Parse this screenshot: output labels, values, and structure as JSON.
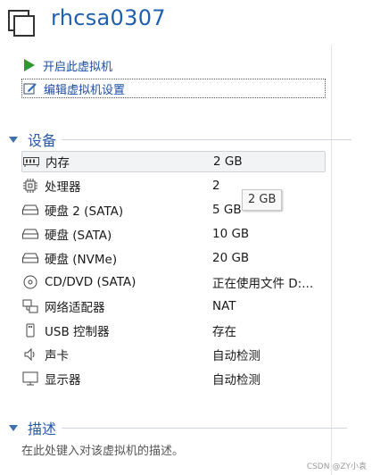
{
  "vm": {
    "title": "rhcsa0307"
  },
  "actions": {
    "start": "开启此虚拟机",
    "edit": "编辑虚拟机设置"
  },
  "devices": {
    "heading": "设备",
    "rows": [
      {
        "name": "内存",
        "value": "2 GB",
        "icon": "memory-icon"
      },
      {
        "name": "处理器",
        "value": "2",
        "icon": "processor-icon"
      },
      {
        "name": "硬盘 2 (SATA)",
        "value": "5 GB",
        "icon": "hard-disk-icon"
      },
      {
        "name": "硬盘 (SATA)",
        "value": "10 GB",
        "icon": "hard-disk-icon"
      },
      {
        "name": "硬盘 (NVMe)",
        "value": "20 GB",
        "icon": "hard-disk-icon"
      },
      {
        "name": "CD/DVD (SATA)",
        "value": "正在使用文件 D:...",
        "icon": "cd-dvd-icon"
      },
      {
        "name": "网络适配器",
        "value": "NAT",
        "icon": "network-adapter-icon"
      },
      {
        "name": "USB 控制器",
        "value": "存在",
        "icon": "usb-icon"
      },
      {
        "name": "声卡",
        "value": "自动检测",
        "icon": "speaker-icon"
      },
      {
        "name": "显示器",
        "value": "自动检测",
        "icon": "display-icon"
      }
    ]
  },
  "tooltip": "2 GB",
  "description": {
    "heading": "描述",
    "placeholder": "在此处键入对该虚拟机的描述。"
  },
  "watermark": "CSDN @ZY小袁",
  "colors": {
    "title": "#1f5fb0",
    "section": "#2a5aa8",
    "start_icon": "#2e9a2e"
  }
}
